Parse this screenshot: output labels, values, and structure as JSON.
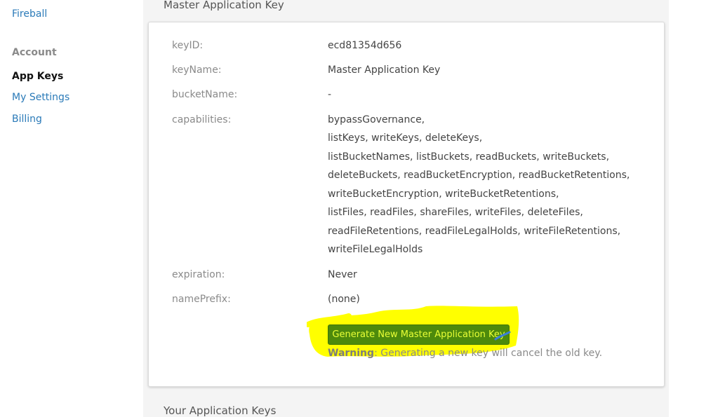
{
  "sidebar": {
    "fireball_link": "Fireball",
    "account_heading": "Account",
    "items": [
      {
        "label": "App Keys",
        "active": true
      },
      {
        "label": "My Settings",
        "active": false
      },
      {
        "label": "Billing",
        "active": false
      }
    ]
  },
  "master_key_section": {
    "title": "Master Application Key",
    "fields": {
      "key_id_label": "keyID:",
      "key_id_value": "ecd81354d656",
      "key_name_label": "keyName:",
      "key_name_value": "Master Application Key",
      "bucket_name_label": "bucketName:",
      "bucket_name_value": "-",
      "capabilities_label": "capabilities:",
      "capabilities_lines": [
        "bypassGovernance,",
        "listKeys, writeKeys, deleteKeys,",
        "listBucketNames, listBuckets, readBuckets, writeBuckets,",
        "deleteBuckets, readBucketEncryption, readBucketRetentions,",
        "writeBucketEncryption, writeBucketRetentions,",
        "listFiles, readFiles, shareFiles, writeFiles, deleteFiles,",
        "readFileRetentions, readFileLegalHolds, writeFileRetentions,",
        "writeFileLegalHolds"
      ],
      "expiration_label": "expiration:",
      "expiration_value": "Never",
      "name_prefix_label": "namePrefix:",
      "name_prefix_value": "(none)"
    },
    "generate_button": "Generate New Master Application Key",
    "warning_label": "Warning",
    "warning_text": ": Generating a new key will cancel the old key."
  },
  "app_keys_section": {
    "title": "Your Application Keys"
  },
  "colors": {
    "link": "#2a7ab8",
    "button_bg": "#4d8a0c",
    "button_text": "#e9ff36",
    "highlight": "#ffff00"
  }
}
